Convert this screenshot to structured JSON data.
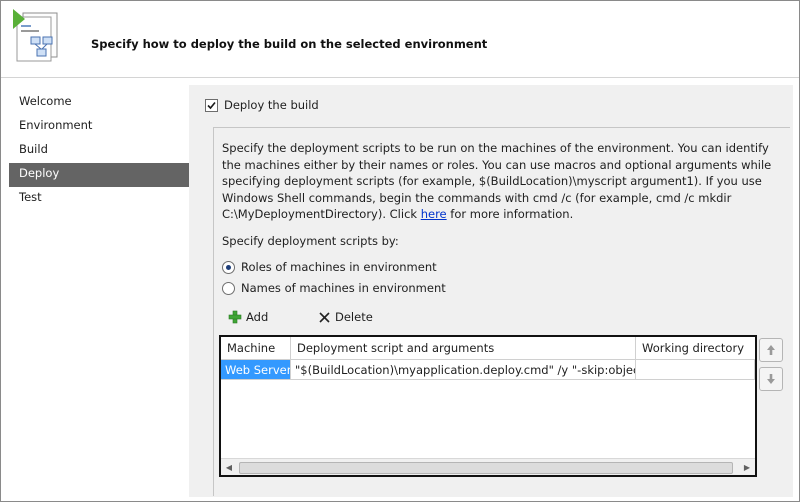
{
  "header": {
    "title": "Specify how to deploy the build on the selected environment",
    "icon": "deployment-wizard-icon"
  },
  "sidebar": {
    "items": [
      {
        "label": "Welcome",
        "selected": false
      },
      {
        "label": "Environment",
        "selected": false
      },
      {
        "label": "Build",
        "selected": false
      },
      {
        "label": "Deploy",
        "selected": true
      },
      {
        "label": "Test",
        "selected": false
      }
    ]
  },
  "deploy": {
    "checkbox_label": "Deploy the build",
    "checked": true,
    "description_before_link": "Specify the deployment scripts to be run on the machines of the environment. You can identify the machines either by their names or roles. You can use macros and optional arguments while specifying deployment scripts (for example, $(BuildLocation)\\myscript argument1). If you use Windows Shell commands, begin the commands with cmd /c (for example, cmd /c mkdir C:\\MyDeploymentDirectory). Click ",
    "link_text": "here",
    "description_after_link": " for more information.",
    "specify_label": "Specify deployment scripts by:",
    "radio_roles": "Roles of machines in environment",
    "radio_names": "Names of machines in environment",
    "selected_radio": "roles",
    "add_label": "Add",
    "delete_label": "Delete"
  },
  "grid": {
    "columns": [
      "Machine",
      "Deployment script and arguments",
      "Working directory"
    ],
    "rows": [
      {
        "machine": "Web Server",
        "script": "\"$(BuildLocation)\\myapplication.deploy.cmd\" /y \"-skip:objectN...",
        "workdir": ""
      }
    ]
  },
  "colors": {
    "selected_nav": "#646464",
    "selected_cell": "#3399ff",
    "link": "#0033cc"
  }
}
